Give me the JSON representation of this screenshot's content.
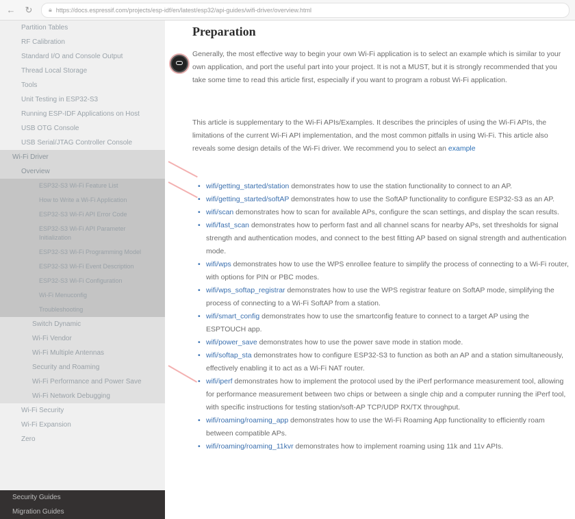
{
  "browser": {
    "url": "https://docs.espressif.com/projects/esp-idf/en/latest/esp32/api-guides/wifi-driver/overview.html"
  },
  "sidebar": {
    "items": [
      {
        "label": "Partition Tables",
        "level": "top"
      },
      {
        "label": "RF Calibration",
        "level": "top"
      },
      {
        "label": "Standard I/O and Console Output",
        "level": "top"
      },
      {
        "label": "Thread Local Storage",
        "level": "top"
      },
      {
        "label": "Tools",
        "level": "top"
      },
      {
        "label": "Unit Testing in ESP32-S3",
        "level": "top"
      },
      {
        "label": "Running ESP-IDF Applications on Host",
        "level": "top"
      },
      {
        "label": "USB OTG Console",
        "level": "top"
      },
      {
        "label": "USB Serial/JTAG Controller Console",
        "level": "top"
      },
      {
        "label": "Wi-Fi Driver",
        "level": "l1"
      },
      {
        "label": "Overview",
        "level": "l2"
      },
      {
        "label": "ESP32-S3 Wi-Fi Feature List",
        "level": "l3"
      },
      {
        "label": "How to Write a Wi-Fi Application",
        "level": "l3"
      },
      {
        "label": "ESP32-S3 Wi-Fi API Error Code",
        "level": "l3"
      },
      {
        "label": "ESP32-S3 Wi-Fi API Parameter Initialization",
        "level": "l3"
      },
      {
        "label": "ESP32-S3 Wi-Fi Programming Model",
        "level": "l3"
      },
      {
        "label": "ESP32-S3 Wi-Fi Event Description",
        "level": "l3"
      },
      {
        "label": "ESP32-S3 Wi-Fi Configuration",
        "level": "l3"
      },
      {
        "label": "Wi-Fi Menuconfig",
        "level": "l3"
      },
      {
        "label": "Troubleshooting",
        "level": "l3"
      },
      {
        "label": "Switch Dynamic",
        "level": "l2b"
      },
      {
        "label": "Wi-Fi Vendor",
        "level": "l2b"
      },
      {
        "label": "Wi-Fi Multiple Antennas",
        "level": "l2b"
      },
      {
        "label": "Security and Roaming",
        "level": "l2b"
      },
      {
        "label": "Wi-Fi Performance and Power Save",
        "level": "l2b"
      },
      {
        "label": "Wi-Fi Network Debugging",
        "level": "l2b"
      },
      {
        "label": "Wi-Fi Security",
        "level": "top"
      },
      {
        "label": "Wi-Fi Expansion",
        "level": "top"
      },
      {
        "label": "Zero",
        "level": "top"
      }
    ],
    "bottom": [
      {
        "label": "Security Guides"
      },
      {
        "label": "Migration Guides"
      }
    ]
  },
  "content": {
    "title": "Preparation",
    "para1": "Generally, the most effective way to begin your own Wi-Fi application is to select an example which is similar to your own application, and port the useful part into your project. It is not a MUST, but it is strongly recommended that you take some time to read this article first, especially if you want to program a robust Wi-Fi application.",
    "para2_text": "This article is supplementary to the Wi-Fi APIs/Examples. It describes the principles of using the Wi-Fi APIs, the limitations of the current Wi-Fi API implementation, and the most common pitfalls in using Wi-Fi. This article also reveals some design details of the Wi-Fi driver. We recommend you to select an",
    "para2_link": "example",
    "bullets": [
      {
        "link": "wifi/getting_started/station",
        "text": " demonstrates how to use the station functionality to connect to an AP."
      },
      {
        "link": "wifi/getting_started/softAP",
        "text": " demonstrates how to use the SoftAP functionality to configure ESP32-S3 as an AP."
      },
      {
        "link": "wifi/scan",
        "text": " demonstrates how to scan for available APs, configure the scan settings, and display the scan results."
      },
      {
        "link": "wifi/fast_scan",
        "text": " demonstrates how to perform fast and all channel scans for nearby APs, set thresholds for signal strength and authentication modes, and connect to the best fitting AP based on signal strength and authentication mode."
      },
      {
        "link": "wifi/wps",
        "text": " demonstrates how to use the WPS enrollee feature to simplify the process of connecting to a Wi-Fi router, with options for PIN or PBC modes."
      },
      {
        "link": "wifi/wps_softap_registrar",
        "text": " demonstrates how to use the WPS registrar feature on SoftAP mode, simplifying the process of connecting to a Wi-Fi SoftAP from a station."
      },
      {
        "link": "wifi/smart_config",
        "text": " demonstrates how to use the smartconfig feature to connect to a target AP using the ESPTOUCH app."
      },
      {
        "link": "wifi/power_save",
        "text": " demonstrates how to use the power save mode in station mode."
      },
      {
        "link": "wifi/softap_sta",
        "text": " demonstrates how to configure ESP32-S3 to function as both an AP and a station simultaneously, effectively enabling it to act as a Wi-Fi NAT router."
      },
      {
        "link": "wifi/iperf",
        "text": " demonstrates how to implement the protocol used by the iPerf performance measurement tool, allowing for performance measurement between two chips or between a single chip and a computer running the iPerf tool, with specific instructions for testing station/soft-AP TCP/UDP RX/TX throughput."
      },
      {
        "link": "wifi/roaming/roaming_app",
        "text": " demonstrates how to use the Wi-Fi Roaming App functionality to efficiently roam between compatible APs."
      },
      {
        "link": "wifi/roaming/roaming_11kvr",
        "text": " demonstrates how to implement roaming using 11k and 11v APIs."
      }
    ]
  },
  "colors": {
    "link": "#2b6fb6",
    "sidebar_bg": "#f0f0f0",
    "sidebar_dark": "#343131",
    "annotation_pink": "#f2a7a7"
  }
}
